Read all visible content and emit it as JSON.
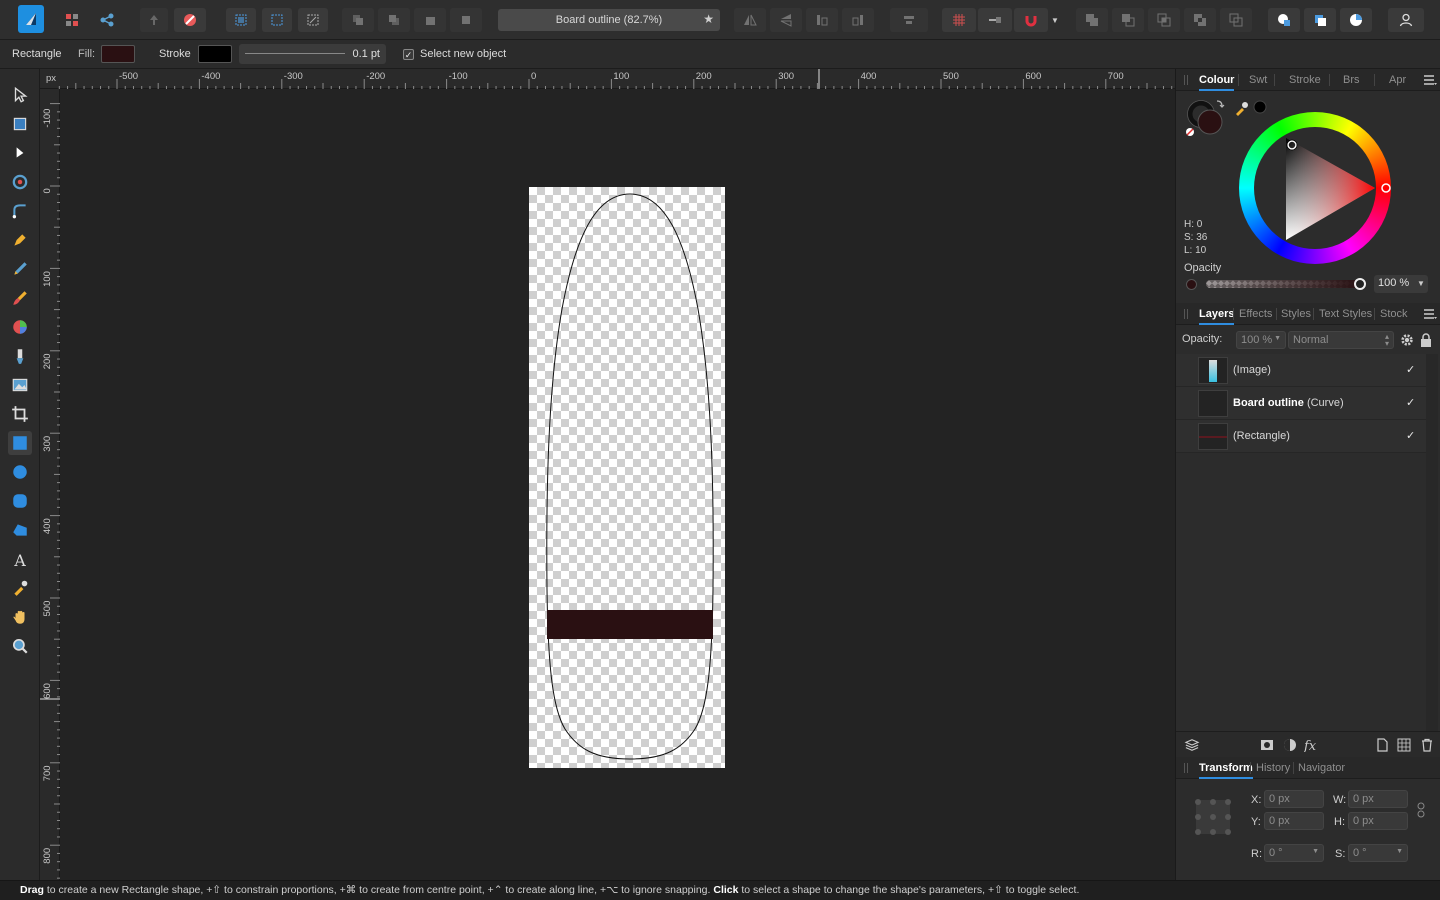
{
  "toolbar": {
    "document_title": "Board outline (82.7%)"
  },
  "context": {
    "tool_name": "Rectangle",
    "fill_label": "Fill:",
    "stroke_label": "Stroke",
    "stroke_width": "0.1 pt",
    "select_new_object_label": "Select new object",
    "fill_color": "#2a1012",
    "stroke_color": "#000000"
  },
  "rulers": {
    "unit": "px",
    "top_ticks": [
      "-500",
      "-400",
      "-300",
      "-200",
      "-100",
      "0",
      "100",
      "200",
      "300",
      "400",
      "500",
      "600",
      "700"
    ],
    "left_ticks": [
      "-100",
      "0",
      "100",
      "200",
      "300",
      "400",
      "500",
      "600",
      "700",
      "800"
    ]
  },
  "colour_panel": {
    "tabs": [
      "Colour",
      "Swt",
      "Stroke",
      "Brs",
      "Apr"
    ],
    "active_tab": "Colour",
    "h": "H: 0",
    "s": "S: 36",
    "l": "L: 10",
    "opacity_label": "Opacity",
    "opacity_value": "100 %",
    "current_color": "#2a1012"
  },
  "layers_panel": {
    "tabs": [
      "Layers",
      "Effects",
      "Styles",
      "Text Styles",
      "Stock"
    ],
    "active_tab": "Layers",
    "opacity_label": "Opacity:",
    "opacity_value": "100 %",
    "blend_mode": "Normal",
    "layers": [
      {
        "name": "(Image)",
        "bold": "",
        "visible": "✓"
      },
      {
        "name": " (Curve)",
        "bold": "Board outline",
        "visible": "✓"
      },
      {
        "name": "(Rectangle)",
        "bold": "",
        "visible": "✓"
      }
    ]
  },
  "transform_panel": {
    "tabs": [
      "Transform",
      "History",
      "Navigator"
    ],
    "active_tab": "Transform",
    "x_label": "X:",
    "x_value": "0 px",
    "y_label": "Y:",
    "y_value": "0 px",
    "w_label": "W:",
    "w_value": "0 px",
    "h_label": "H:",
    "h_value": "0 px",
    "r_label": "R:",
    "r_value": "0 °",
    "s_label": "S:",
    "s_value": "0 °"
  },
  "status": {
    "s1": "Drag",
    "s2": " to create a new Rectangle shape, +⇧ to constrain proportions, +⌘ to create from centre point, +⌃ to create along line, +⌥ to ignore snapping. ",
    "s3": "Click",
    "s4": " to select a shape to change the shape's parameters, +⇧ to toggle select."
  }
}
